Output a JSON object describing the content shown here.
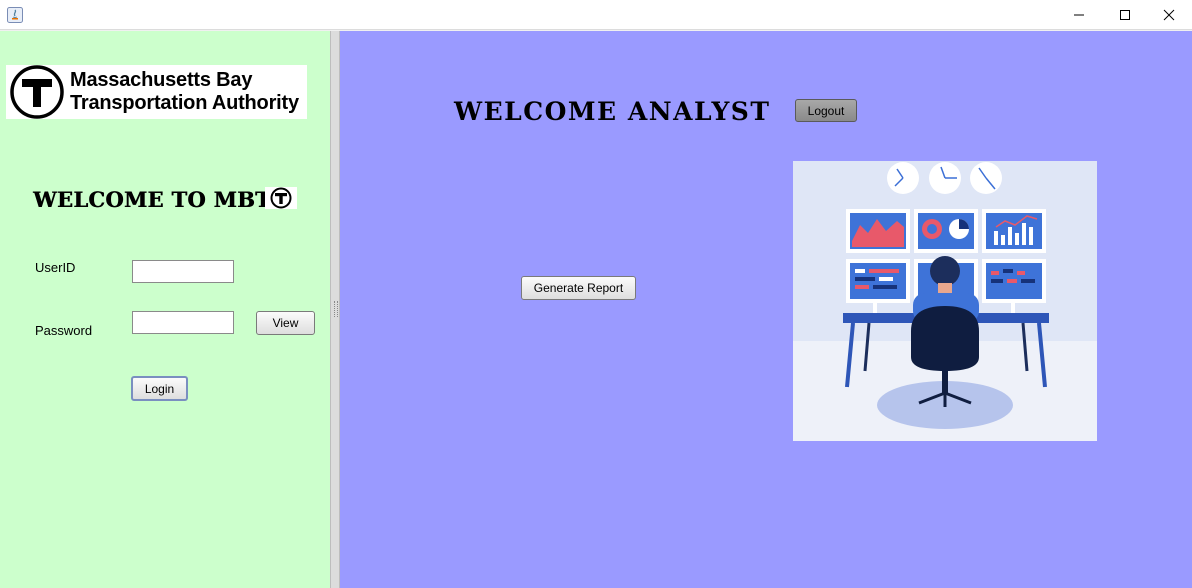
{
  "window": {
    "app_icon": "java-app-icon",
    "controls": {
      "minimize": "minimize-icon",
      "maximize": "maximize-icon",
      "close": "close-icon"
    }
  },
  "colors": {
    "left_panel_bg": "#ccffcc",
    "right_panel_bg": "#9a9aff"
  },
  "left": {
    "logo": {
      "line1": "Massachusetts Bay",
      "line2": "Transportation Authority",
      "icon": "mbta-t-logo"
    },
    "welcome_text": "WELCOME TO MBTA",
    "userid_label": "UserID",
    "userid_value": "",
    "password_label": "Password",
    "password_value": "",
    "view_button": "View",
    "login_button": "Login"
  },
  "right": {
    "welcome_text": "WELCOME ANALYST",
    "logout_button": "Logout",
    "generate_report_button": "Generate Report",
    "illustration": "analyst-dashboard-illustration"
  }
}
